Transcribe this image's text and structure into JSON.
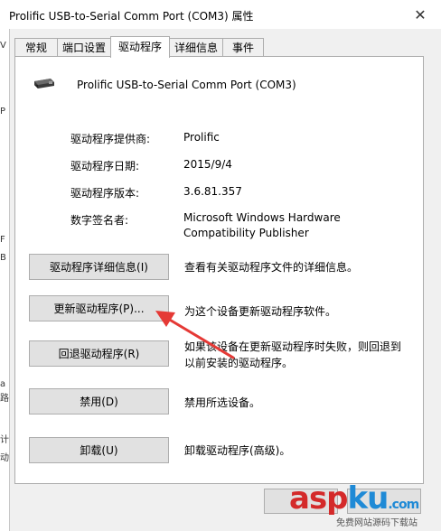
{
  "window": {
    "title": "Prolific USB-to-Serial Comm Port (COM3) 属性",
    "close_symbol": "✕"
  },
  "left_strip_chars": [
    "V",
    "P",
    "F",
    "B",
    "a",
    "路",
    "计",
    "动"
  ],
  "tabs": [
    {
      "label": "常规",
      "active": false
    },
    {
      "label": "端口设置",
      "active": false
    },
    {
      "label": "驱动程序",
      "active": true
    },
    {
      "label": "详细信息",
      "active": false
    },
    {
      "label": "事件",
      "active": false
    }
  ],
  "device": {
    "name": "Prolific USB-to-Serial Comm Port (COM3)",
    "icon": "usb-serial-device-icon"
  },
  "properties": {
    "provider_label": "驱动程序提供商:",
    "provider_value": "Prolific",
    "date_label": "驱动程序日期:",
    "date_value": "2015/9/4",
    "version_label": "驱动程序版本:",
    "version_value": "3.6.81.357",
    "signer_label": "数字签名者:",
    "signer_value": "Microsoft Windows Hardware Compatibility Publisher"
  },
  "actions": {
    "details_label": "驱动程序详细信息(I)",
    "details_desc": "查看有关驱动程序文件的详细信息。",
    "update_label": "更新驱动程序(P)...",
    "update_desc": "为这个设备更新驱动程序软件。",
    "rollback_label": "回退驱动程序(R)",
    "rollback_desc": "如果该设备在更新驱动程序时失败，则回退到以前安装的驱动程序。",
    "disable_label": "禁用(D)",
    "disable_desc": "禁用所选设备。",
    "uninstall_label": "卸载(U)",
    "uninstall_desc": "卸载驱动程序(高级)。"
  },
  "watermark": {
    "logo_a": "asp",
    "logo_b": "ku",
    "logo_c": ".com",
    "subtitle": "免费网站源码下载站"
  },
  "colors": {
    "arrow": "#e53935",
    "panel_bg": "#ffffff",
    "window_bg": "#f0f0f0",
    "button_bg": "#e1e1e1"
  }
}
